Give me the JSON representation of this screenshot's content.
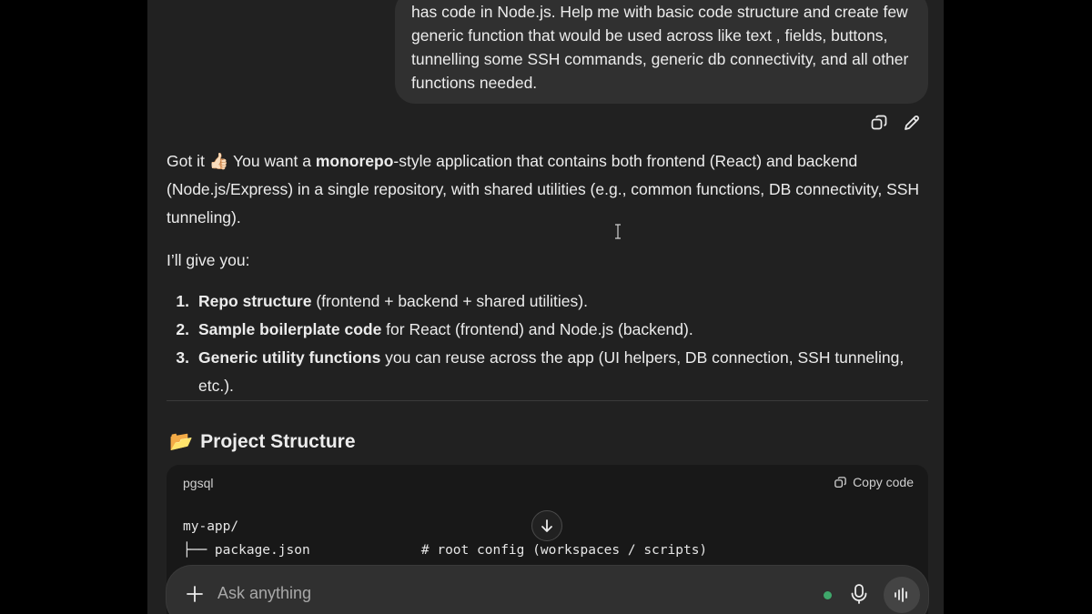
{
  "user_message": {
    "lines": [
      "has code in Node.js. Help me with basic code structure and create few",
      "generic function that would be used across like text , fields, buttons,",
      "tunnelling some SSH commands, generic db connectivity, and all other",
      "functions needed."
    ]
  },
  "message_actions": {
    "copy_icon": "copy-icon",
    "edit_icon": "pencil-icon"
  },
  "assistant": {
    "p1_a": "Got it ",
    "p1_emoji": "👍🏻",
    "p1_b": " You want a ",
    "p1_bold": "monorepo",
    "p1_c": "-style application that contains both frontend (React) and backend",
    "p1_line2": "(Node.js/Express) in a single repository, with shared utilities (e.g., common functions, DB connectivity, SSH",
    "p1_line3": "tunneling).",
    "p2": "I’ll give you:",
    "steps": [
      {
        "num": "1.",
        "bold": "Repo structure",
        "rest": " (frontend + backend + shared utilities)."
      },
      {
        "num": "2.",
        "bold": "Sample boilerplate code",
        "rest": " for React (frontend) and Node.js (backend)."
      },
      {
        "num": "3.",
        "bold": "Generic utility functions",
        "rest": " you can reuse across the app (UI helpers, DB connection, SSH tunneling, etc.)."
      }
    ]
  },
  "section": {
    "emoji": "📂",
    "title": "Project Structure"
  },
  "code_block": {
    "language": "pgsql",
    "copy_label": "Copy code",
    "lines": [
      "my-app/",
      "├── package.json              # root config (workspaces / scripts)"
    ]
  },
  "composer": {
    "placeholder": "Ask anything",
    "status_color": "#3fa86b"
  },
  "colors": {
    "panel": "#212121",
    "bubble": "#303030",
    "code_bg": "#181818",
    "text": "#ececec"
  }
}
